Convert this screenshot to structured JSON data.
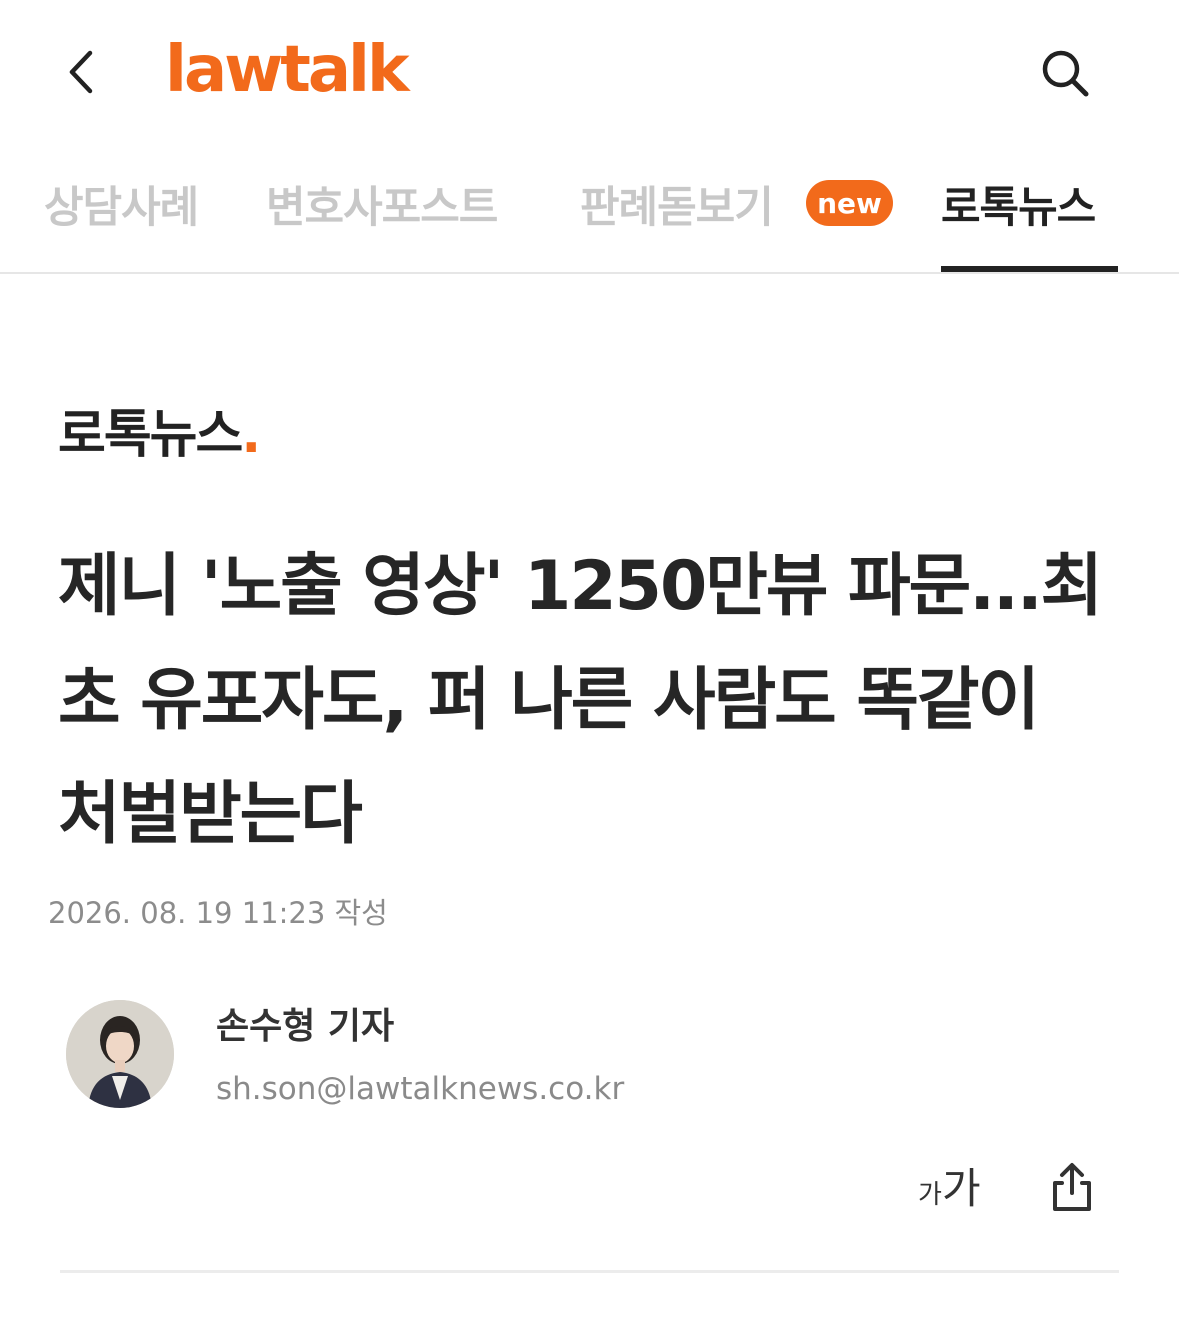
{
  "header": {
    "logo_text": "lawtalk",
    "brand_color": "#f26a1b",
    "back_icon": "chevron-left-icon",
    "search_icon": "search-icon"
  },
  "tabs": [
    {
      "label": "상담사례",
      "active": false
    },
    {
      "label": "변호사포스트",
      "active": false
    },
    {
      "label": "판례돋보기",
      "active": false,
      "badge": "new"
    },
    {
      "label": "로톡뉴스",
      "active": true
    }
  ],
  "section": {
    "label": "로톡뉴스",
    "dot": "."
  },
  "article": {
    "title": "제니 '노출 영상' 1250만뷰 파문...최초 유포자도, 퍼 나른 사람도 똑같이 처벌받는다",
    "date": "2026. 08. 19 11:23 작성"
  },
  "author": {
    "name": "손수형 기자",
    "email": "sh.son@lawtalknews.co.kr"
  },
  "actions": {
    "font_size_small": "가",
    "font_size_large": "가",
    "share_icon": "share-icon"
  }
}
